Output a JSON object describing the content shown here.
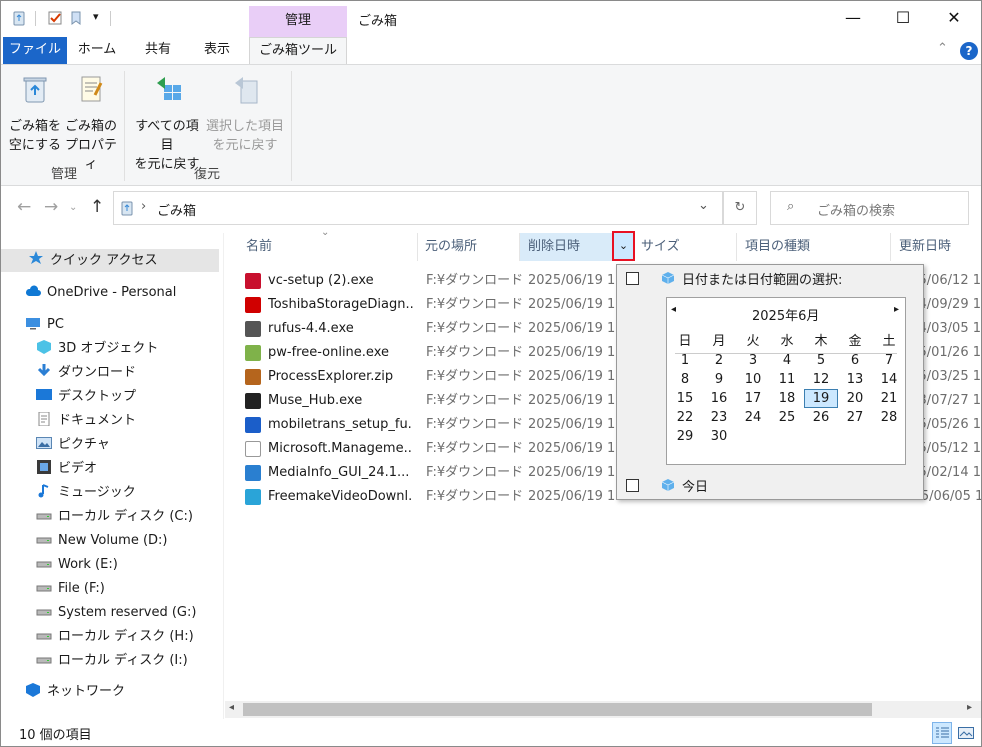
{
  "window": {
    "title": "ごみ箱",
    "context_tab": "管理",
    "min_icon": "minimize-icon",
    "max_icon": "maximize-icon",
    "close_icon": "close-icon"
  },
  "tabs": {
    "file": "ファイル",
    "home": "ホーム",
    "share": "共有",
    "view": "表示",
    "recycle_tools": "ごみ箱ツール"
  },
  "ribbon": {
    "empty_line1": "ごみ箱を",
    "empty_line2": "空にする",
    "props_line1": "ごみ箱の",
    "props_line2": "プロパティ",
    "group_manage": "管理",
    "restore_all_line1": "すべての項目",
    "restore_all_line2": "を元に戻す",
    "restore_sel_line1": "選択した項目",
    "restore_sel_line2": "を元に戻す",
    "group_restore": "復元"
  },
  "address": {
    "path": "ごみ箱",
    "search_placeholder": "ごみ箱の検索"
  },
  "sidebar": {
    "items": [
      {
        "label": "クイック アクセス",
        "icon": "star-icon"
      },
      {
        "label": "OneDrive - Personal",
        "icon": "cloud-icon"
      },
      {
        "label": "PC",
        "icon": "pc-icon"
      },
      {
        "label": "3D オブジェクト",
        "icon": "cube-icon"
      },
      {
        "label": "ダウンロード",
        "icon": "download-icon"
      },
      {
        "label": "デスクトップ",
        "icon": "desktop-icon"
      },
      {
        "label": "ドキュメント",
        "icon": "document-icon"
      },
      {
        "label": "ピクチャ",
        "icon": "picture-icon"
      },
      {
        "label": "ビデオ",
        "icon": "video-icon"
      },
      {
        "label": "ミュージック",
        "icon": "music-icon"
      },
      {
        "label": "ローカル ディスク (C:)",
        "icon": "drive-icon"
      },
      {
        "label": "New Volume (D:)",
        "icon": "drive-icon"
      },
      {
        "label": "Work (E:)",
        "icon": "drive-icon"
      },
      {
        "label": "File (F:)",
        "icon": "drive-icon"
      },
      {
        "label": "System reserved (G:)",
        "icon": "drive-icon"
      },
      {
        "label": "ローカル ディスク (H:)",
        "icon": "drive-icon"
      },
      {
        "label": "ローカル ディスク (I:)",
        "icon": "drive-icon"
      },
      {
        "label": "ネットワーク",
        "icon": "network-icon"
      }
    ]
  },
  "columns": {
    "name": "名前",
    "location": "元の場所",
    "deleted": "削除日時",
    "size": "サイズ",
    "type": "項目の種類",
    "modified": "更新日時"
  },
  "files": [
    {
      "name": "vc-setup (2).exe",
      "location": "F:¥ダウンロード",
      "deleted": "2025/06/19 1...",
      "modified": "5/06/12 1"
    },
    {
      "name": "ToshibaStorageDiagn...",
      "location": "F:¥ダウンロード",
      "deleted": "2025/06/19 1...",
      "modified": "4/09/29 1"
    },
    {
      "name": "rufus-4.4.exe",
      "location": "F:¥ダウンロード",
      "deleted": "2025/06/19 1...",
      "modified": "4/03/05 1"
    },
    {
      "name": "pw-free-online.exe",
      "location": "F:¥ダウンロード",
      "deleted": "2025/06/19 1...",
      "modified": "5/01/26 1"
    },
    {
      "name": "ProcessExplorer.zip",
      "location": "F:¥ダウンロード",
      "deleted": "2025/06/19 1...",
      "modified": "5/03/25 1"
    },
    {
      "name": "Muse_Hub.exe",
      "location": "F:¥ダウンロード",
      "deleted": "2025/06/19 1...",
      "modified": "3/07/27 1"
    },
    {
      "name": "mobiletrans_setup_fu...",
      "location": "F:¥ダウンロード",
      "deleted": "2025/06/19 1...",
      "modified": "5/05/26 1"
    },
    {
      "name": "Microsoft.Manageme...",
      "location": "F:¥ダウンロード",
      "deleted": "2025/06/19 1...",
      "modified": "5/05/12 1"
    },
    {
      "name": "MediaInfo_GUI_24.1...",
      "location": "F:¥ダウンロード",
      "deleted": "2025/06/19 1...",
      "modified": "5/02/14 1"
    },
    {
      "name": "FreemakeVideoDownl...",
      "location": "F:¥ダウンロード",
      "deleted": "2025/06/19 1...",
      "modified": "2025/06/05 1"
    }
  ],
  "date_filter": {
    "range_label": "日付または日付範囲の選択:",
    "month": "2025年6月",
    "weekdays": [
      "日",
      "月",
      "火",
      "水",
      "木",
      "金",
      "土"
    ],
    "days": [
      "1",
      "2",
      "3",
      "4",
      "5",
      "6",
      "7",
      "8",
      "9",
      "10",
      "11",
      "12",
      "13",
      "14",
      "15",
      "16",
      "17",
      "18",
      "19",
      "20",
      "21",
      "22",
      "23",
      "24",
      "25",
      "26",
      "27",
      "28",
      "29",
      "30"
    ],
    "selected_day": "19",
    "today_label": "今日"
  },
  "status": {
    "count": "10 個の項目"
  },
  "colors": {
    "accent": "#1b66c9",
    "context_tab": "#e9cef7",
    "highlight_border": "#e81123"
  }
}
